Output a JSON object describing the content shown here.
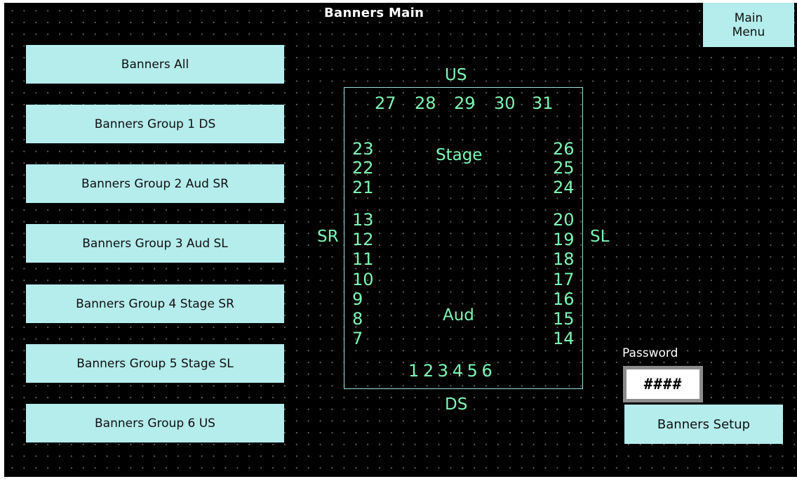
{
  "title": "Banners Main",
  "main_menu": {
    "line1": "Main",
    "line2": "Menu"
  },
  "buttons": [
    "Banners All",
    "Banners Group 1 DS",
    "Banners Group 2 Aud SR",
    "Banners Group 3 Aud SL",
    "Banners Group 4 Stage SR",
    "Banners Group 5 Stage SL",
    "Banners Group 6 US"
  ],
  "stage_map": {
    "us": "US",
    "ds": "DS",
    "sr": "SR",
    "sl": "SL",
    "stage": "Stage",
    "aud": "Aud",
    "top_row": [
      "27",
      "28",
      "29",
      "30",
      "31"
    ],
    "bottom_row": "1 2 3 4 5 6",
    "left_col": [
      "23",
      "22",
      "21",
      "13",
      "12",
      "11",
      "10",
      "9",
      "8",
      "7"
    ],
    "right_col": [
      "26",
      "25",
      "24",
      "20",
      "19",
      "18",
      "17",
      "16",
      "15",
      "14"
    ]
  },
  "password": {
    "label": "Password",
    "value": "####"
  },
  "setup_button": "Banners Setup",
  "colors": {
    "background": "#000000",
    "button": "#b5ecec",
    "map_text": "#7ff7b6",
    "map_border": "#9fe0de"
  }
}
